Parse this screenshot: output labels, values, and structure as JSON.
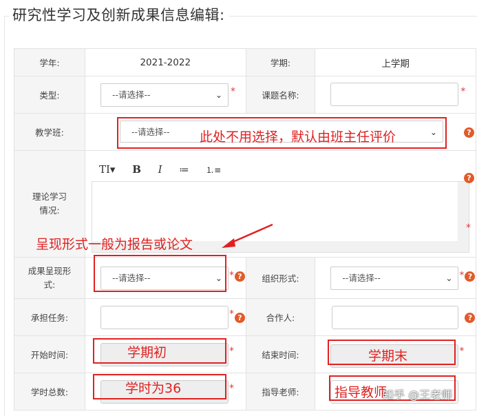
{
  "section_title": "研究性学习及创新成果信息编辑:",
  "rows": {
    "year": {
      "label": "学年:",
      "value": "2021-2022"
    },
    "term": {
      "label": "学期:",
      "value": "上学期"
    },
    "type": {
      "label": "类型:",
      "select": "--请选择--"
    },
    "topic": {
      "label": "课题名称:",
      "value": ""
    },
    "class": {
      "label": "教学班:",
      "select": "--请选择--"
    },
    "theory": {
      "label": "理论学习情况:"
    },
    "presentation": {
      "label": "成果呈现形式:",
      "select": "--请选择--"
    },
    "org_form": {
      "label": "组织形式:",
      "select": "--请选择--"
    },
    "task": {
      "label": "承担任务:",
      "value": ""
    },
    "partner": {
      "label": "合作人:",
      "value": ""
    },
    "start_time": {
      "label": "开始时间:"
    },
    "end_time": {
      "label": "结束时间:"
    },
    "total_hours": {
      "label": "学时总数:"
    },
    "advisor": {
      "label": "指导老师:"
    }
  },
  "editor": {
    "toolbar": [
      "TI▾",
      "B",
      "I",
      "≔",
      "⒈≡"
    ]
  },
  "annotations": {
    "class_note": "此处不用选择，默认由班主任评价",
    "presentation_note": "呈现形式一般为报告或论文",
    "start_note": "学期初",
    "end_note": "学期末",
    "hours_note": "学时为36",
    "advisor_note": "指导教师"
  },
  "watermark": "知乎 @王老师",
  "colors": {
    "required": "#e4393c",
    "annotation": "#e02020",
    "help": "#e05b2a"
  }
}
